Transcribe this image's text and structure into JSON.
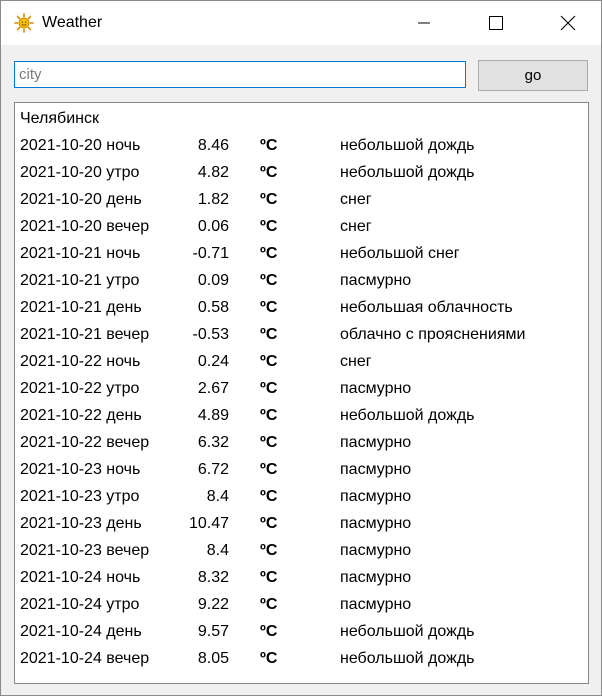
{
  "window": {
    "title": "Weather",
    "controls": {
      "minimize_icon": "minimize-icon",
      "maximize_icon": "maximize-icon",
      "close_icon": "close-icon"
    },
    "app_icon": "sun-icon"
  },
  "search": {
    "value": "",
    "placeholder": "city"
  },
  "go_button": {
    "label": "go"
  },
  "result": {
    "city": "Челябинск",
    "rows": [
      {
        "date": "2021-10-20 ночь",
        "temp": "8.46",
        "unit": "ºС",
        "desc": "небольшой дождь"
      },
      {
        "date": "2021-10-20 утро",
        "temp": "4.82",
        "unit": "ºС",
        "desc": "небольшой дождь"
      },
      {
        "date": "2021-10-20 день",
        "temp": "1.82",
        "unit": "ºС",
        "desc": "снег"
      },
      {
        "date": "2021-10-20 вечер",
        "temp": "0.06",
        "unit": "ºС",
        "desc": "снег"
      },
      {
        "date": "2021-10-21 ночь",
        "temp": "-0.71",
        "unit": "ºС",
        "desc": "небольшой снег"
      },
      {
        "date": "2021-10-21 утро",
        "temp": "0.09",
        "unit": "ºС",
        "desc": "пасмурно"
      },
      {
        "date": "2021-10-21 день",
        "temp": "0.58",
        "unit": "ºС",
        "desc": "небольшая облачность"
      },
      {
        "date": "2021-10-21 вечер",
        "temp": "-0.53",
        "unit": "ºС",
        "desc": "облачно с прояснениями"
      },
      {
        "date": "2021-10-22 ночь",
        "temp": "0.24",
        "unit": "ºС",
        "desc": "снег"
      },
      {
        "date": "2021-10-22 утро",
        "temp": "2.67",
        "unit": "ºС",
        "desc": "пасмурно"
      },
      {
        "date": "2021-10-22 день",
        "temp": "4.89",
        "unit": "ºС",
        "desc": "небольшой дождь"
      },
      {
        "date": "2021-10-22 вечер",
        "temp": "6.32",
        "unit": "ºС",
        "desc": "пасмурно"
      },
      {
        "date": "2021-10-23 ночь",
        "temp": "6.72",
        "unit": "ºС",
        "desc": "пасмурно"
      },
      {
        "date": "2021-10-23 утро",
        "temp": "8.4",
        "unit": "ºС",
        "desc": "пасмурно"
      },
      {
        "date": "2021-10-23 день",
        "temp": "10.47",
        "unit": "ºС",
        "desc": "пасмурно"
      },
      {
        "date": "2021-10-23 вечер",
        "temp": "8.4",
        "unit": "ºС",
        "desc": "пасмурно"
      },
      {
        "date": "2021-10-24 ночь",
        "temp": "8.32",
        "unit": "ºС",
        "desc": "пасмурно"
      },
      {
        "date": "2021-10-24 утро",
        "temp": "9.22",
        "unit": "ºС",
        "desc": "пасмурно"
      },
      {
        "date": "2021-10-24 день",
        "temp": "9.57",
        "unit": "ºС",
        "desc": "небольшой дождь"
      },
      {
        "date": "2021-10-24 вечер",
        "temp": "8.05",
        "unit": "ºС",
        "desc": "небольшой дождь"
      }
    ]
  }
}
